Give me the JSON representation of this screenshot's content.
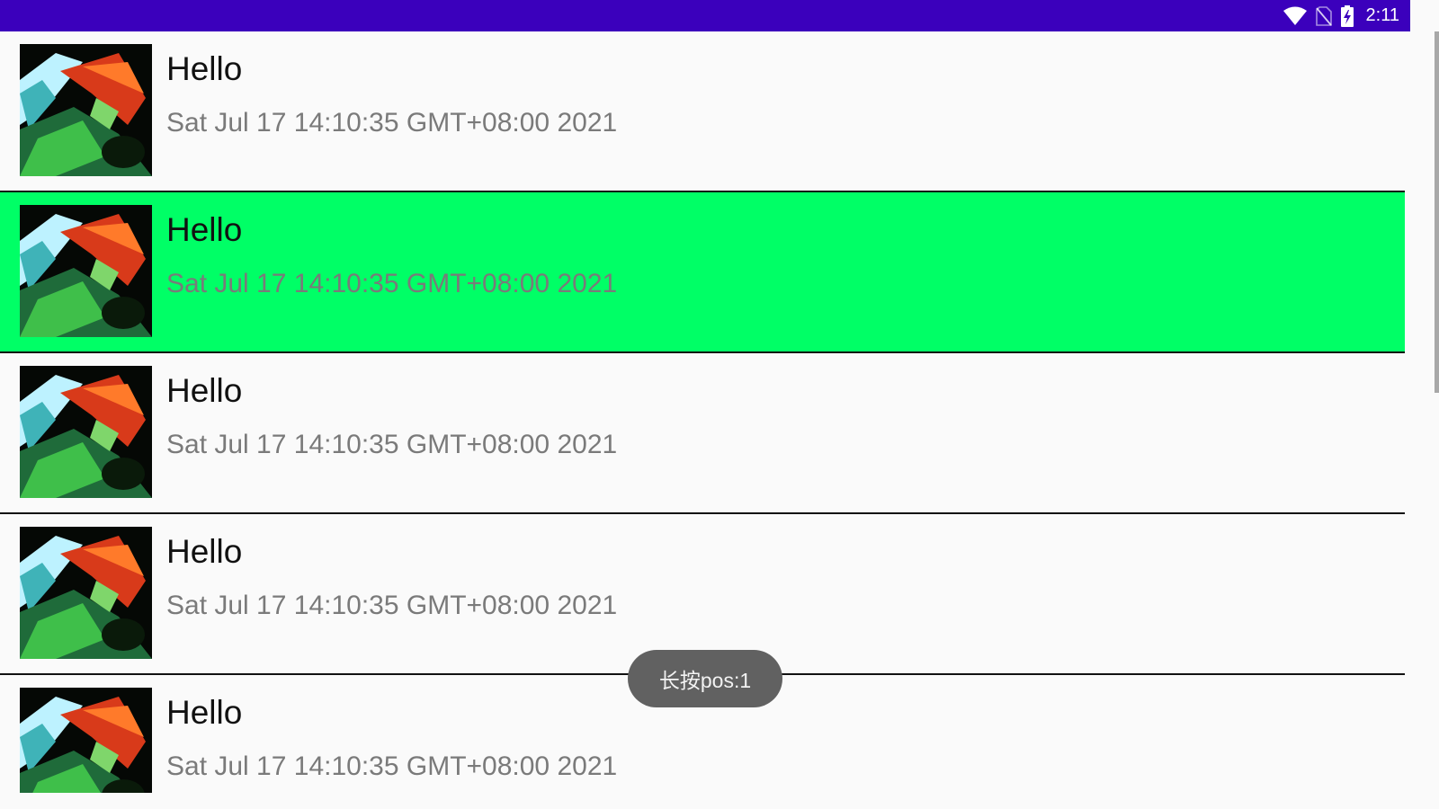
{
  "status_bar": {
    "time": "2:11",
    "icons": [
      "wifi-icon",
      "no-sim-icon",
      "battery-charging-icon"
    ],
    "background_color": "#3b00bc"
  },
  "list": {
    "items": [
      {
        "title": "Hello",
        "subtitle": "Sat Jul 17 14:10:35 GMT+08:00 2021",
        "selected": false
      },
      {
        "title": "Hello",
        "subtitle": "Sat Jul 17 14:10:35 GMT+08:00 2021",
        "selected": true
      },
      {
        "title": "Hello",
        "subtitle": "Sat Jul 17 14:10:35 GMT+08:00 2021",
        "selected": false
      },
      {
        "title": "Hello",
        "subtitle": "Sat Jul 17 14:10:35 GMT+08:00 2021",
        "selected": false
      },
      {
        "title": "Hello",
        "subtitle": "Sat Jul 17 14:10:35 GMT+08:00 2021",
        "selected": false
      }
    ],
    "selected_color": "#00ff66"
  },
  "toast": {
    "text": "长按pos:1"
  }
}
